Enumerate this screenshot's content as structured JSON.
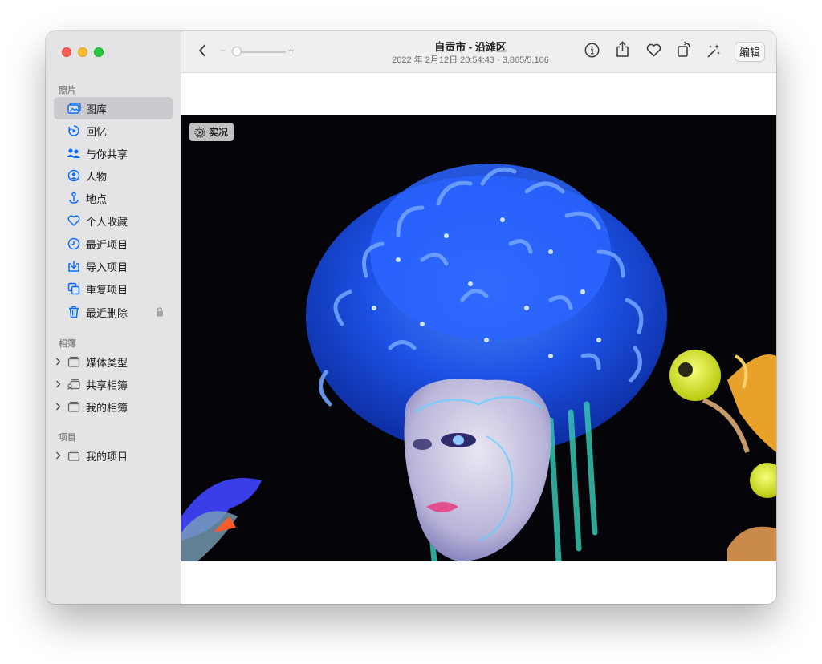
{
  "window": {
    "controls": [
      "close",
      "minimize",
      "zoom"
    ]
  },
  "sidebar": {
    "sections": {
      "photos": "照片",
      "albums": "相簿",
      "projects": "项目"
    },
    "items": [
      {
        "label": "图库",
        "icon": "photo-library-icon",
        "active": true
      },
      {
        "label": "回忆",
        "icon": "memories-icon"
      },
      {
        "label": "与你共享",
        "icon": "shared-with-you-icon"
      },
      {
        "label": "人物",
        "icon": "people-icon"
      },
      {
        "label": "地点",
        "icon": "places-icon"
      },
      {
        "label": "个人收藏",
        "icon": "heart-icon"
      },
      {
        "label": "最近项目",
        "icon": "clock-icon"
      },
      {
        "label": "导入项目",
        "icon": "import-icon"
      },
      {
        "label": "重复项目",
        "icon": "duplicates-icon"
      },
      {
        "label": "最近删除",
        "icon": "trash-icon",
        "locked": true
      }
    ],
    "albums": [
      {
        "label": "媒体类型",
        "icon": "folder-stack-icon"
      },
      {
        "label": "共享相簿",
        "icon": "shared-album-icon"
      },
      {
        "label": "我的相簿",
        "icon": "folder-stack-icon"
      }
    ],
    "projects": [
      {
        "label": "我的项目",
        "icon": "folder-stack-icon"
      }
    ]
  },
  "toolbar": {
    "title": "自贡市 - 沿滩区",
    "subtitle": "2022 年 2月12日 20:54:43 · 3,865/5,106",
    "zoom_minus": "−",
    "zoom_plus": "+",
    "edit_label": "编辑",
    "icons": [
      "back-chevron-icon",
      "info-icon",
      "share-icon",
      "heart-icon",
      "rotate-icon",
      "magic-wand-icon"
    ]
  },
  "photo": {
    "live_label": "实况",
    "accent_color": "#1e5fff"
  },
  "colors": {
    "accent": "#0a6cff",
    "sidebar_bg": "#e4e3e5",
    "toolbar_bg": "#efeff1"
  }
}
